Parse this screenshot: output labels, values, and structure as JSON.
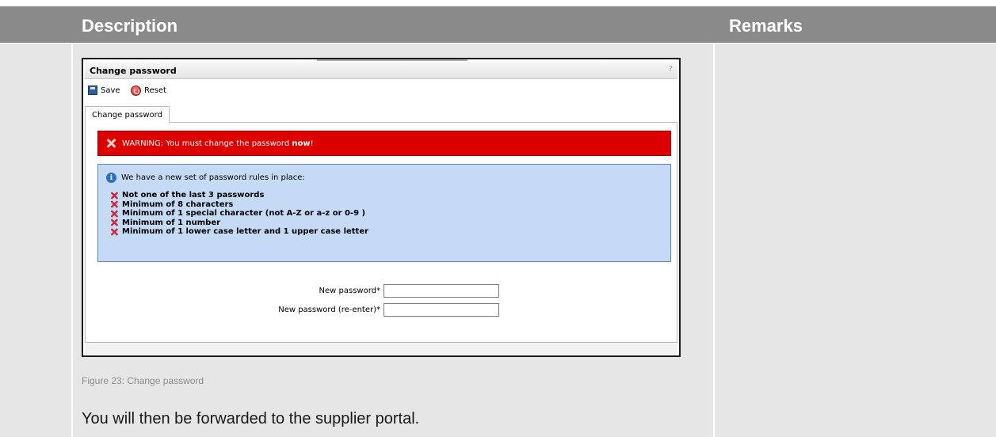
{
  "header": {
    "description_label": "Description",
    "remarks_label": "Remarks"
  },
  "screenshot": {
    "title": "Change password",
    "help_label": "?",
    "toolbar": {
      "save_label": "Save",
      "reset_label": "Reset"
    },
    "tab_label": "Change password",
    "warning": {
      "prefix": "WARNING: You must change the password ",
      "emphasis": "now",
      "suffix": "!"
    },
    "info": {
      "heading": "We have a new set of password rules in place:",
      "rules": [
        "Not one of the last 3 passwords",
        "Minimum of 8 characters",
        "Minimum of 1 special character (not A-Z or a-z or 0-9 )",
        "Minimum of 1 number",
        "Minimum of 1 lower case letter and 1 upper case letter"
      ]
    },
    "form": {
      "new_password_label": "New password*",
      "new_password_value": "",
      "reenter_label": "New password (re-enter)*",
      "reenter_value": ""
    }
  },
  "caption": "Figure 23: Change password",
  "paragraph": "You will then be forwarded to the supplier portal."
}
